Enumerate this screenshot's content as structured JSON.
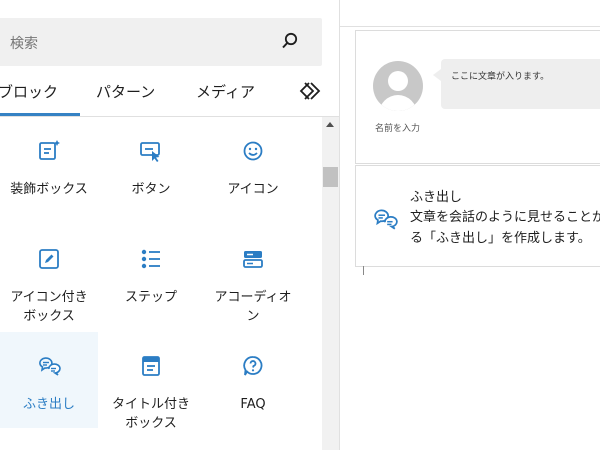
{
  "search": {
    "placeholder": "検索"
  },
  "tabs": [
    {
      "label": "ブロック",
      "active": true
    },
    {
      "label": "パターン",
      "active": false
    },
    {
      "label": "メディア",
      "active": false
    }
  ],
  "blocks": [
    {
      "label": "装飾ボックス",
      "icon": "decoration-box-icon"
    },
    {
      "label": "ボタン",
      "icon": "button-cursor-icon"
    },
    {
      "label": "アイコン",
      "icon": "smiley-icon"
    },
    {
      "label": "アイコン付き",
      "label2": "ボックス",
      "icon": "icon-box-icon"
    },
    {
      "label": "ステップ",
      "icon": "step-list-icon"
    },
    {
      "label": "アコーディオ",
      "label2": "ン",
      "icon": "accordion-icon"
    },
    {
      "label": "ふき出し",
      "icon": "speech-bubble-icon",
      "selected": true
    },
    {
      "label": "タイトル付き",
      "label2": "ボックス",
      "icon": "title-box-icon"
    },
    {
      "label": "FAQ",
      "icon": "faq-icon"
    }
  ],
  "preview": {
    "avatar_name": "名前を入力",
    "bubble_text": "ここに文章が入ります。"
  },
  "block_info": {
    "title": "ふき出し",
    "desc_line1": "文章を会話のように見せることが",
    "desc_line2": "る「ふき出し」を作成します。"
  },
  "colors": {
    "accent": "#3582c4",
    "selected_bg": "#f0f7fc",
    "icon": "#2b7dc4"
  }
}
